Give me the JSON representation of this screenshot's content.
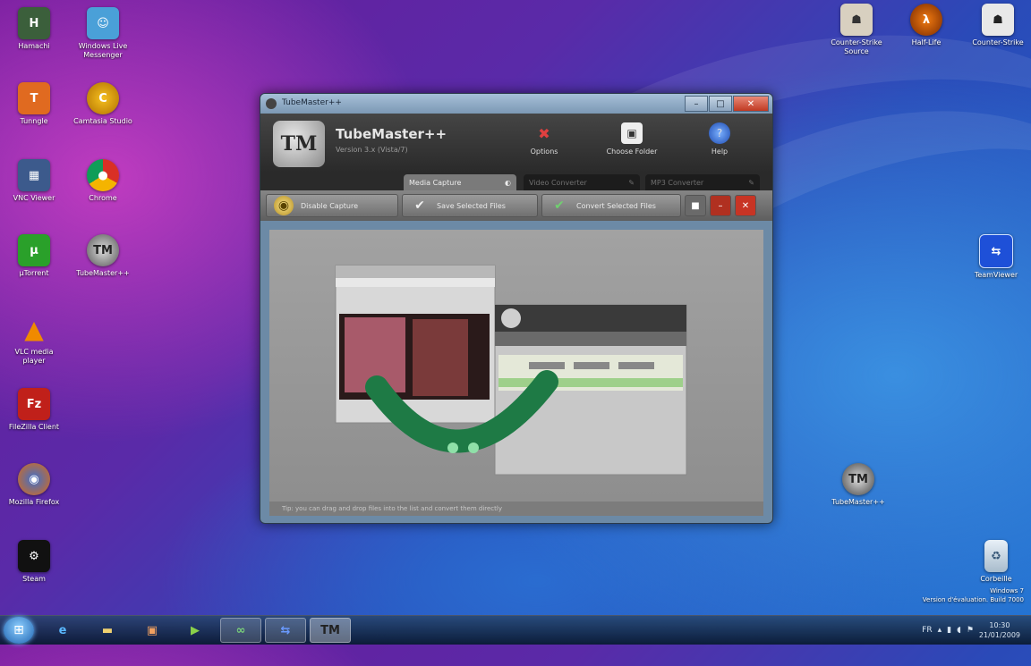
{
  "window": {
    "title": "TubeMaster++",
    "app_name": "TubeMaster++",
    "app_subtitle": "Version 3.x (Vista/7)",
    "logo_text": "TM",
    "header_buttons": [
      "Options",
      "Choose Folder",
      "Help"
    ],
    "tabs": [
      "Media Capture",
      "Video Converter",
      "MP3 Converter"
    ],
    "toolbar": {
      "start_capture": "Disable Capture",
      "save_selected": "Save Selected Files",
      "convert_selected": "Convert Selected Files"
    },
    "status_text": "Tip: you can drag and drop files into the list and convert them directly"
  },
  "desktop_icons_left": [
    "Hamachi",
    "Tunngle",
    "VNC Viewer",
    "Chrome",
    "µTorrent",
    "TubeMaster++",
    "VLC media player",
    "FileZilla Client",
    "Mozilla Firefox",
    "Steam"
  ],
  "desktop_icons_left2": [
    "Windows Live Messenger",
    "Camtasia Studio"
  ],
  "desktop_icons_right": [
    "Counter-Strike Source",
    "Half-Life",
    "Counter-Strike",
    "TeamViewer",
    "TubeMaster++",
    "Corbeille"
  ],
  "watermark": {
    "line1": "Windows 7",
    "line2": "Version d'évaluation. Build 7000"
  },
  "tray": {
    "lang": "FR",
    "time": "10:30",
    "date": "21/01/2009"
  },
  "colors": {
    "tubemaster_green": "#1e7a45",
    "accent_blue": "#1d62b0",
    "close_red": "#c03a22"
  }
}
